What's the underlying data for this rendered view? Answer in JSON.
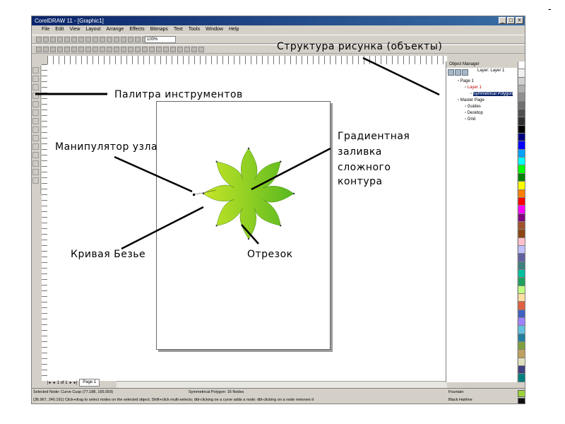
{
  "corner_mark": "-",
  "window": {
    "title": "CorelDRAW 11 - [Graphic1]"
  },
  "menu": [
    "File",
    "Edit",
    "View",
    "Layout",
    "Arrange",
    "Effects",
    "Bitmaps",
    "Text",
    "Tools",
    "Window",
    "Help"
  ],
  "toolbar": {
    "zoom_value": "100%"
  },
  "page_tabs": {
    "count_label": "1 of 1",
    "active_tab": "Page 1"
  },
  "object_manager": {
    "title": "Object Manager",
    "layer_label": "Layer:",
    "layer_name": "Layer 1",
    "rows": [
      {
        "text": "Page 1",
        "level": 0,
        "style": ""
      },
      {
        "text": "Layer 1",
        "level": 1,
        "style": "red"
      },
      {
        "text": "Symmetrical Polygon",
        "level": 2,
        "style": "selected"
      },
      {
        "text": "Master Page",
        "level": 0,
        "style": ""
      },
      {
        "text": "Guides",
        "level": 1,
        "style": ""
      },
      {
        "text": "Desktop",
        "level": 1,
        "style": ""
      },
      {
        "text": "Grid",
        "level": 1,
        "style": ""
      }
    ]
  },
  "status": {
    "line1": "Selected Node: Curve Cusp (77.188, 165.059)",
    "object": "Symmetrical Polygon: 16 Nodes",
    "line2": "(36.967, 240.191)   Click+drag to select nodes on the selected object; Shift+click multi-selects; dbl-clicking on a curve adds a node; dbl-clicking on a node removes it",
    "fill": "Fountain",
    "stroke": "Black  Hairline"
  },
  "annotations": {
    "structure": "Структура рисунка (объекты)",
    "toolbox": "Палитра  инструментов",
    "node_handle": "Манипулятор  узла",
    "gradient_l1": "Градиентная",
    "gradient_l2": "заливка",
    "gradient_l3": "сложного",
    "gradient_l4": "контура",
    "bezier": "Кривая  Безье",
    "segment": "Отрезок"
  },
  "colors": {
    "star_fill_start": "#c7e628",
    "star_fill_end": "#58b81f",
    "title_bar": "#0a246a",
    "palette": [
      "#ffffff",
      "#f0f0f0",
      "#d0d0d0",
      "#b0b0b0",
      "#909090",
      "#707070",
      "#505050",
      "#303030",
      "#000000",
      "#00007f",
      "#0000ff",
      "#00a0ff",
      "#00ffff",
      "#00ff00",
      "#008000",
      "#ffff00",
      "#ff8000",
      "#ff0000",
      "#ff00ff",
      "#800080",
      "#a0522d",
      "#8b4513",
      "#ffc0cb",
      "#c0c0ff",
      "#6060a0",
      "#408080",
      "#00c0a0",
      "#20a060",
      "#c0ff80",
      "#ffe0a0",
      "#e06040",
      "#4060c0",
      "#a080ff",
      "#60c0e0",
      "#2080a0",
      "#80a040",
      "#c0a060",
      "#e0e0c0",
      "#404080",
      "#008080"
    ]
  }
}
